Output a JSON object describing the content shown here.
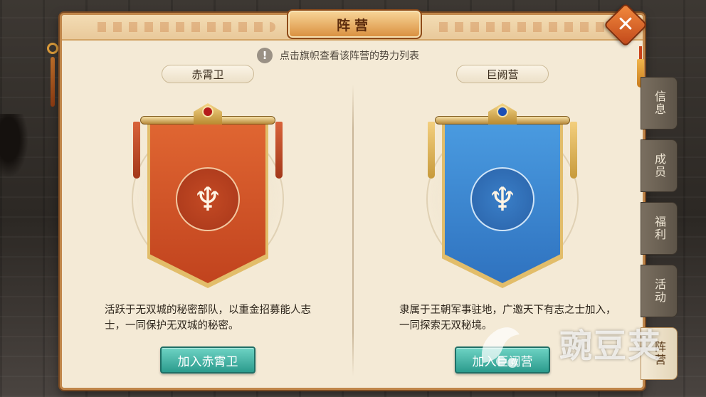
{
  "window": {
    "title": "阵营",
    "close_symbol": "✕"
  },
  "notice": {
    "icon": "exclamation-icon",
    "icon_symbol": "!",
    "text": "点击旗帜查看该阵营的势力列表"
  },
  "camps": [
    {
      "id": "red",
      "name": "赤霄卫",
      "color": "#d2552a",
      "emblem_symbol": "♆",
      "description": "活跃于无双城的秘密部队，以重金招募能人志士，一同保护无双城的秘密。",
      "join_label": "加入赤霄卫"
    },
    {
      "id": "blue",
      "name": "巨阙营",
      "color": "#3a87cf",
      "emblem_symbol": "♆",
      "description": "隶属于王朝军事驻地，广邀天下有志之士加入，一同探索无双秘境。",
      "join_label": "加入巨阙营"
    }
  ],
  "side_tabs": [
    {
      "label": "信息",
      "active": false
    },
    {
      "label": "成员",
      "active": false
    },
    {
      "label": "福利",
      "active": false
    },
    {
      "label": "活动",
      "active": false
    },
    {
      "label": "阵营",
      "active": true
    }
  ],
  "watermark": {
    "text": "豌豆荚"
  },
  "colors": {
    "panel_bg": "#f4ead6",
    "button_teal": "#2b9b8d",
    "close_orange": "#e0652a",
    "red_banner": "#d2552a",
    "blue_banner": "#3a87cf"
  }
}
